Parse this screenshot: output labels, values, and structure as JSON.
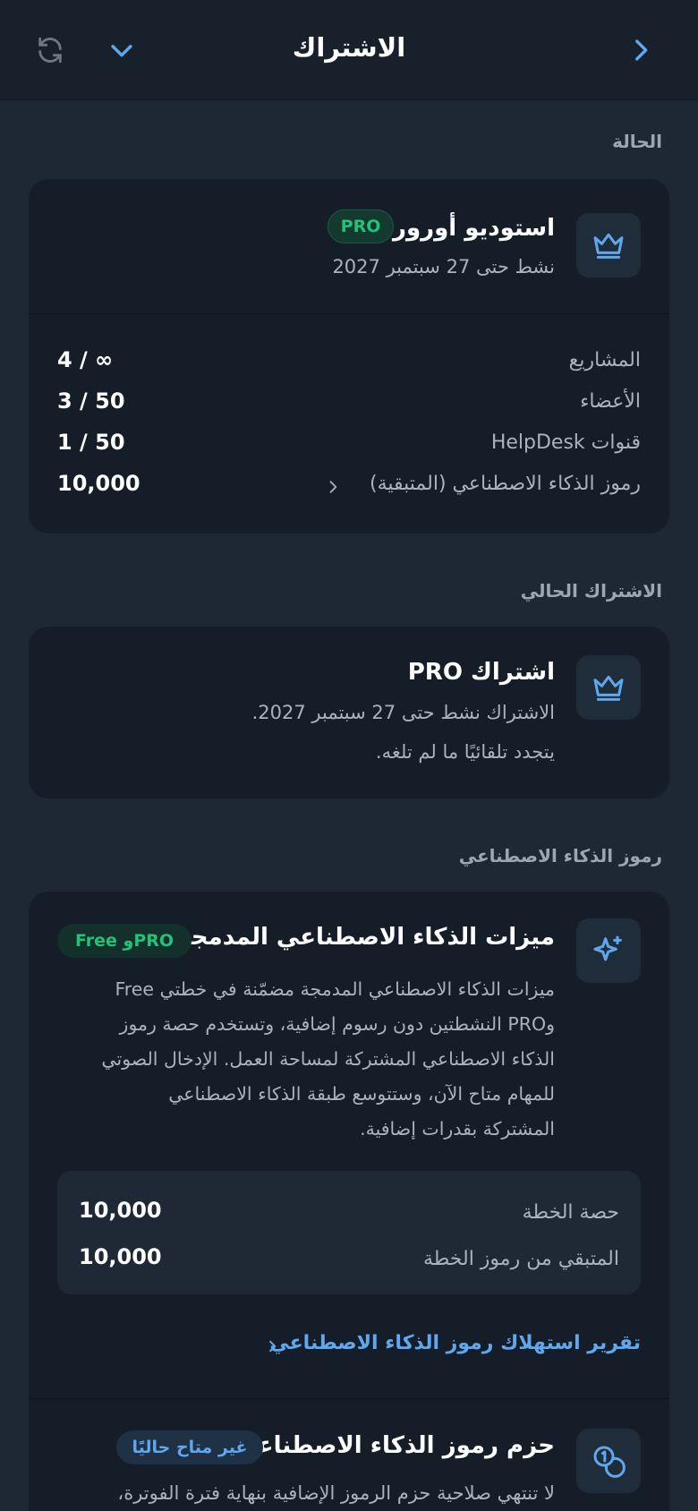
{
  "header": {
    "title": "الاشتراك",
    "back_icon": "chevron-right-icon",
    "collapse_icon": "chevron-down-icon",
    "refresh_icon": "refresh-icon"
  },
  "status": {
    "section_label": "الحالة",
    "workspace_name": "استوديو أورورا",
    "plan_badge": "PRO",
    "active_until": "نشط حتى 27 سبتمبر 2027",
    "rows": [
      {
        "label": "المشاريع",
        "value": "4 / ∞"
      },
      {
        "label": "الأعضاء",
        "value": "3 / 50"
      },
      {
        "label": "قنوات HelpDesk",
        "value": "1 / 50"
      },
      {
        "label": "رموز الذكاء الاصطناعي (المتبقية)",
        "value": "10,000"
      }
    ]
  },
  "current_subscription": {
    "section_label": "الاشتراك الحالي",
    "title": "اشتراك PRO",
    "line1": "الاشتراك نشط حتى 27 سبتمبر 2027.",
    "line2": "يتجدد تلقائيًا ما لم تلغه."
  },
  "ai_tokens": {
    "section_label": "رموز الذكاء الاصطناعي",
    "features_title": "ميزات الذكاء الاصطناعي المدمجة",
    "features_badge": "Free وPRO",
    "description_lines": [
      "ميزات الذكاء الاصطناعي المدمجة مضمّنة في خطتي Free",
      "وPRO النشطتين دون رسوم إضافية، وتستخدم حصة رموز",
      "الذكاء الاصطناعي المشتركة لمساحة العمل. الإدخال الصوتي",
      "للمهام متاح الآن، وستتوسع طبقة الذكاء الاصطناعي",
      "المشتركة بقدرات إضافية."
    ],
    "quota_rows": [
      {
        "label": "حصة الخطة",
        "value": "10,000"
      },
      {
        "label": "المتبقي من رموز الخطة",
        "value": "10,000"
      }
    ],
    "usage_report_link": "تقرير استهلاك رموز الذكاء الاصطناعي",
    "packs_title": "حزم رموز الذكاء الاصطناعي",
    "packs_badge": "غير متاح حاليًا",
    "packs_desc": "لا تنتهي صلاحية حزم الرموز الإضافية بنهاية فترة الفوترة،"
  },
  "colors": {
    "accent": "#5fa8f0",
    "pro_green": "#22c27a",
    "background": "#1e2834",
    "card": "#151e28"
  }
}
